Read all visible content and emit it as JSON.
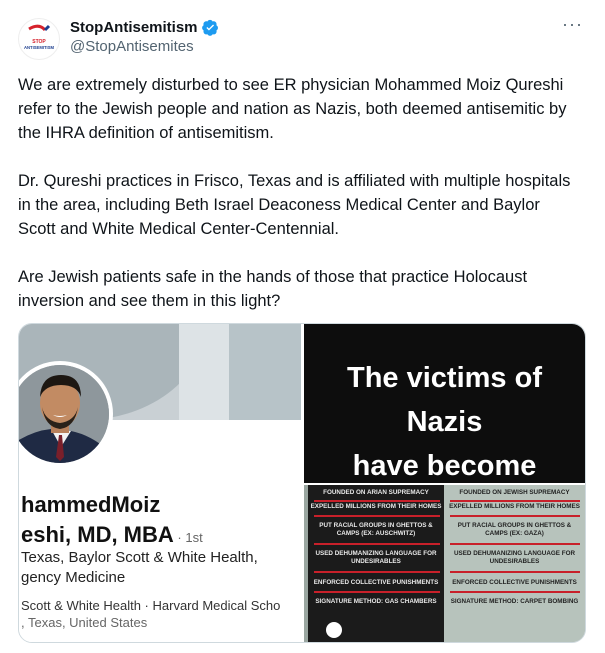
{
  "tweet": {
    "display_name": "StopAntisemitism",
    "handle": "@StopAntisemites",
    "more_label": "···",
    "text": "We are extremely disturbed to see ER physician Mohammed Moiz Qureshi refer to the Jewish people and nation as Nazis, both deemed antisemitic by the IHRA definition of antisemitism.\n\nDr. Qureshi practices in Frisco, Texas and is affiliated with multiple hospitals in the area, including Beth Israel Deaconess Medical Center and Baylor Scott and White Medical Center-Centennial.\n\nAre Jewish patients safe in the hands of those that practice Holocaust inversion and see them in this light?",
    "avatar_text": "STOP ANTISEMITISM"
  },
  "media": {
    "linkedin": {
      "name": "hammedMoiz",
      "title": "eshi, MD, MBA",
      "degree": " · 1st",
      "line1": "Texas, Baylor Scott & White Health,",
      "line2": "gency Medicine",
      "line3": "Scott & White Health · Harvard Medical Scho",
      "line4": ", Texas, United States"
    },
    "poster": {
      "headline_1": "The victims of",
      "headline_2": "Nazis",
      "headline_3": "have become",
      "rows": [
        {
          "left": "FOUNDED ON ARIAN SUPREMACY",
          "right": "FOUNDED ON JEWISH SUPREMACY"
        },
        {
          "left": "EXPELLED MILLIONS FROM THEIR HOMES",
          "right": "EXPELLED MILLIONS FROM THEIR HOMES"
        },
        {
          "left": "PUT RACIAL GROUPS IN GHETTOS & CAMPS (EX: AUSCHWITZ)",
          "right": "PUT RACIAL GROUPS IN GHETTOS & CAMPS (EX: GAZA)"
        },
        {
          "left": "USED DEHUMANIZING LANGUAGE FOR UNDESIRABLES",
          "right": "USED DEHUMANIZING LANGUAGE FOR UNDESIRABLES"
        },
        {
          "left": "ENFORCED COLLECTIVE PUNISHMENTS",
          "right": "ENFORCED COLLECTIVE PUNISHMENTS"
        },
        {
          "left": "SIGNATURE METHOD: GAS CHAMBERS",
          "right": "SIGNATURE METHOD: CARPET BOMBING"
        }
      ]
    }
  },
  "colors": {
    "verified": "#1d9bf0",
    "text": "#0f1419",
    "secondary": "#536471",
    "brand_red": "#d6212b",
    "brand_blue": "#1e3f8f"
  },
  "icons": {
    "verified": "verified-badge-icon",
    "more": "more-options-icon"
  }
}
